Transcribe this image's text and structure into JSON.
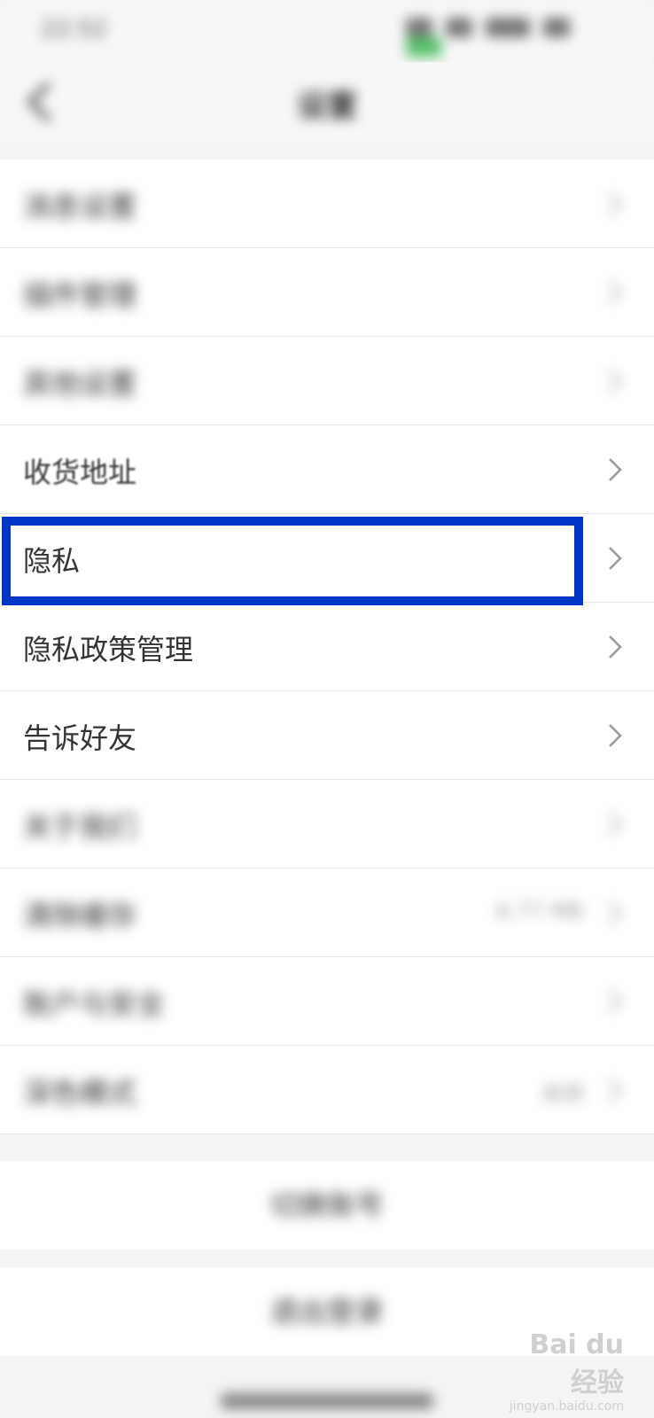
{
  "status_bar": {
    "time": "22:52"
  },
  "header": {
    "title": "设置",
    "back_icon": "chevron-left-icon"
  },
  "settings": {
    "items": [
      {
        "label": "消息设置",
        "blurred": true
      },
      {
        "label": "插件管理",
        "blurred": true
      },
      {
        "label": "其他设置",
        "blurred": true
      },
      {
        "label": "收货地址",
        "blurred": false
      },
      {
        "label": "隐私",
        "blurred": false,
        "highlighted": true
      },
      {
        "label": "隐私政策管理",
        "blurred": false
      },
      {
        "label": "告诉好友",
        "blurred": false
      },
      {
        "label": "关于我们",
        "blurred": true
      },
      {
        "label": "清除缓存",
        "value": "6.77 MB",
        "blurred": true
      },
      {
        "label": "账户与安全",
        "blurred": true
      },
      {
        "label": "深色模式",
        "value": "关闭",
        "blurred": true
      }
    ],
    "switch_account": "切换账号",
    "logout": "退出登录"
  },
  "watermark": {
    "brand": "Bai du 经验",
    "url": "jingyan.baidu.com"
  },
  "colors": {
    "highlight": "#0036c8",
    "battery": "#56c16a"
  }
}
